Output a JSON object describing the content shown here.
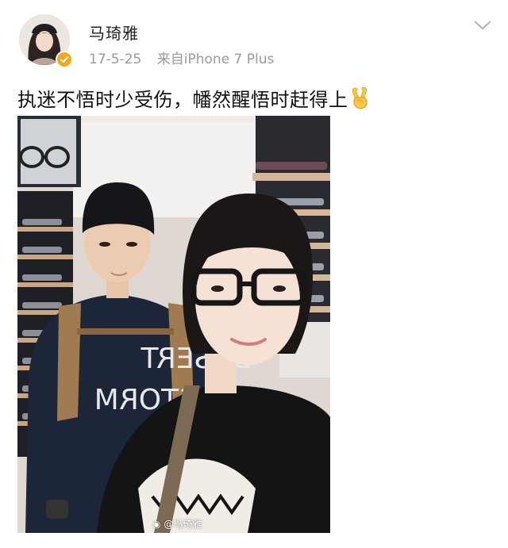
{
  "post": {
    "author": "马琦雅",
    "date": "17-5-25",
    "source_prefix": "来自",
    "source_device": "iPhone 7 Plus",
    "text": "执迷不悟时少受伤，幡然醒悟时赶得上",
    "emoji": "victory-hand"
  },
  "photo": {
    "watermark": "@马琦雅"
  },
  "icons": {
    "menu": "chevron-down-icon",
    "verified": "verified-badge-icon"
  },
  "colors": {
    "verified_badge": "#f5a623",
    "meta_text": "#9a9a9a"
  }
}
